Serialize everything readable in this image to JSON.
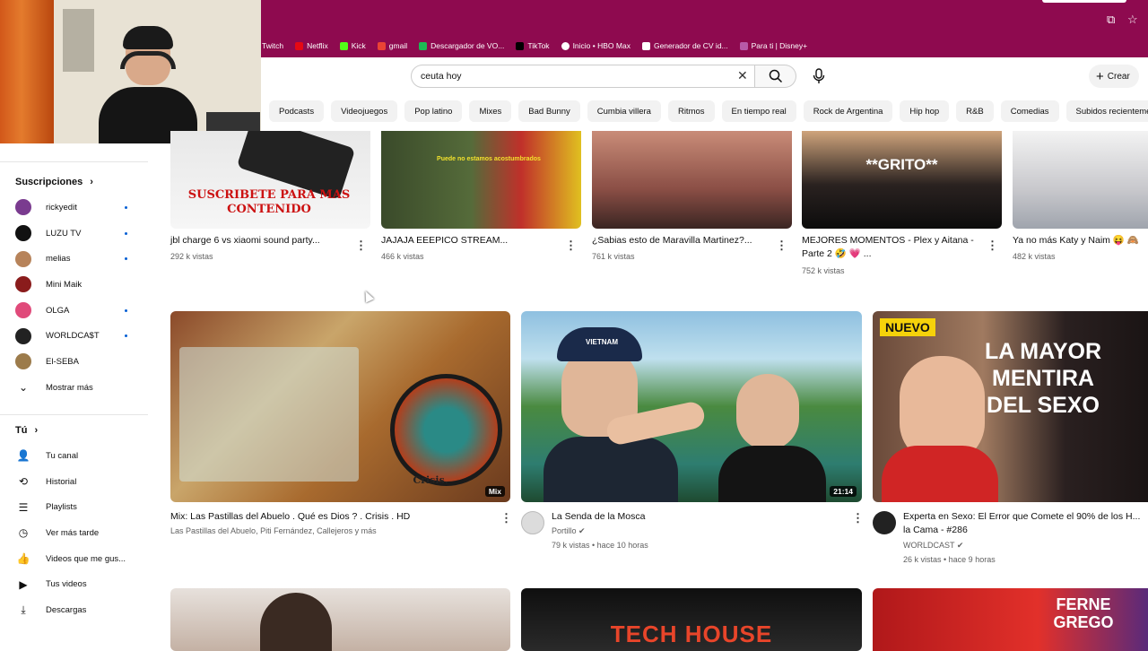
{
  "bookmarks": [
    "Twitch",
    "Netflix",
    "Kick",
    "gmail",
    "Descargador de VO...",
    "TikTok",
    "Inicio • HBO Max",
    "Generador de CV id...",
    "Para ti | Disney+"
  ],
  "search": {
    "value": "ceuta hoy"
  },
  "header": {
    "create_label": "Crear"
  },
  "chips": [
    "Podcasts",
    "Videojuegos",
    "Pop latino",
    "Mixes",
    "Bad Bunny",
    "Cumbia villera",
    "Ritmos",
    "En tiempo real",
    "Rock de Argentina",
    "Hip hop",
    "R&B",
    "Comedias",
    "Subidos recientemente"
  ],
  "sidebar": {
    "subscriptions_title": "Suscripciones",
    "subscriptions": [
      {
        "name": "rickyedit",
        "color": "#7a3b8f",
        "dot": true
      },
      {
        "name": "LUZU TV",
        "color": "#111111",
        "dot": true
      },
      {
        "name": "melias",
        "color": "#b7835a",
        "dot": true
      },
      {
        "name": "Mini Maik",
        "color": "#8a1c1c",
        "dot": false
      },
      {
        "name": "OLGA",
        "color": "#e04a7a",
        "dot": true
      },
      {
        "name": "WORLDCA$T",
        "color": "#222222",
        "dot": true
      },
      {
        "name": "El-SEBA",
        "color": "#9c7b4b",
        "dot": false
      }
    ],
    "show_more": "Mostrar más",
    "you_title": "Tú",
    "you_items": [
      "Tu canal",
      "Historial",
      "Playlists",
      "Ver más tarde",
      "Videos que me gus...",
      "Tus videos",
      "Descargas"
    ]
  },
  "shorts_row": [
    {
      "title": "jbl charge 6 vs xiaomi sound party...",
      "views": "292 k vistas",
      "overlay": "SUSCRIBETE PARA MAS CONTENIDO"
    },
    {
      "title": "JAJAJA EEEPICO STREAM...",
      "views": "466 k vistas",
      "overlay": "Puede no estamos acostumbrados"
    },
    {
      "title": "¿Sabias esto de Maravilla Martinez?...",
      "views": "761 k vistas",
      "overlay": ""
    },
    {
      "title": "MEJORES MOMENTOS - Plex y Aitana - Parte 2 🤣 💗 ...",
      "views": "752 k vistas",
      "overlay": "**GRITO**"
    },
    {
      "title": "Ya no más Katy y Naim 😝 🙈",
      "views": "482 k vistas",
      "overlay": ""
    }
  ],
  "videos": [
    {
      "title": "Mix: Las Pastillas del Abuelo . Qué es Dios ? . Crisis . HD",
      "channel": "Las Pastillas del Abuelo, Piti Fernández, Callejeros y más",
      "meta": "",
      "badge": "Mix",
      "thumb_text": "Crisis."
    },
    {
      "title": "La Senda de la Mosca",
      "channel": "Portillo ✔",
      "meta": "79 k vistas • hace 10 horas",
      "badge": "21:14",
      "thumb_text": "VIETNAM"
    },
    {
      "title": "Experta en Sexo: El Error que Comete el 90% de los H... la Cama - #286",
      "channel": "WORLDCAST ✔",
      "meta": "26 k vistas • hace 9 horas",
      "badge": "",
      "thumb_text": "LA MAYOR MENTIRA DEL SEXO",
      "thumb_tag": "NUEVO"
    }
  ],
  "bottom_row_text": [
    "TECH HOUSE",
    "FERNE GREGO"
  ]
}
